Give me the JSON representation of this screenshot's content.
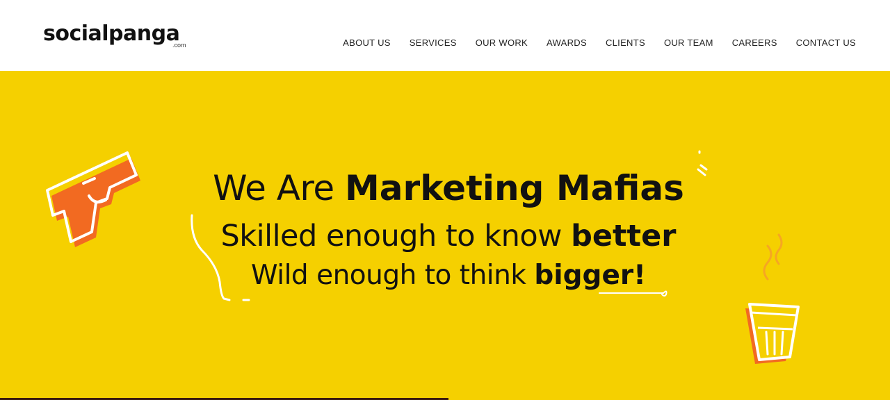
{
  "brand": {
    "name": "socialpanga",
    "suffix": ".com"
  },
  "nav": {
    "items": [
      {
        "label": "ABOUT US"
      },
      {
        "label": "SERVICES"
      },
      {
        "label": "OUR WORK"
      },
      {
        "label": "AWARDS"
      },
      {
        "label": "CLIENTS"
      },
      {
        "label": "OUR TEAM"
      },
      {
        "label": "CAREERS"
      },
      {
        "label": "CONTACT US"
      }
    ]
  },
  "hero": {
    "line1_light": "We Are ",
    "line1_bold": "Marketing Mafias",
    "line2_light": "Skilled enough to know ",
    "line2_bold": "better",
    "line3_light": "Wild enough to think ",
    "line3_bold": "bigger!"
  },
  "colors": {
    "hero_background": "#f5d000",
    "accent_orange": "#f26a21",
    "text": "#111111"
  },
  "icons": {
    "left_illustration": "pistol-icon",
    "right_illustration": "tea-glass-icon"
  }
}
